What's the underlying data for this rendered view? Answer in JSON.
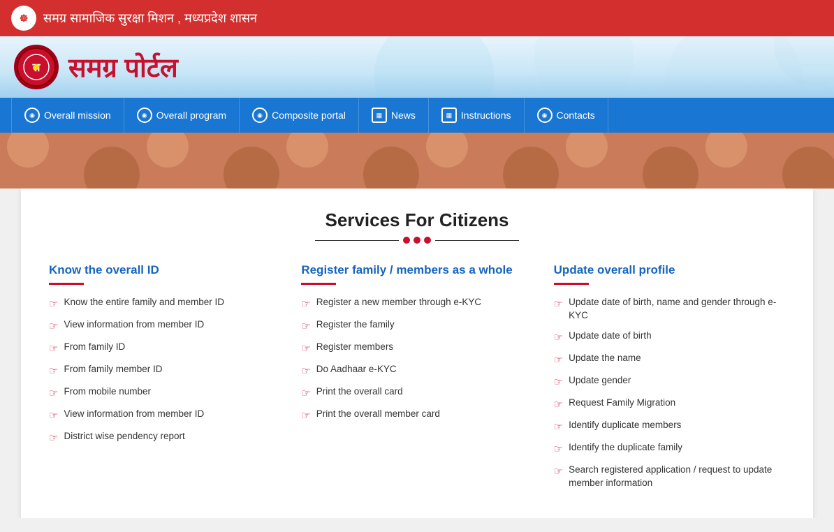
{
  "topHeader": {
    "title": "समग्र सामाजिक सुरक्षा मिशन , मध्यप्रदेश शासन",
    "emblem": "☸"
  },
  "logo": {
    "text": "समग्र पोर्टल",
    "symbol": "स"
  },
  "navbar": {
    "items": [
      {
        "label": "Overall mission",
        "icon": "◉"
      },
      {
        "label": "Overall program",
        "icon": "◉"
      },
      {
        "label": "Composite portal",
        "icon": "◉"
      },
      {
        "label": "News",
        "icon": "▦"
      },
      {
        "label": "Instructions",
        "icon": "▦"
      },
      {
        "label": "Contacts",
        "icon": "◉"
      }
    ]
  },
  "main": {
    "sectionTitle": "Services For Citizens",
    "columns": [
      {
        "title": "Know the overall ID",
        "items": [
          "Know the entire family and member ID",
          "View information from member ID",
          "From family ID",
          "From family member ID",
          "From mobile number",
          "View information from member ID",
          "District wise pendency report"
        ]
      },
      {
        "title": "Register family / members as a whole",
        "items": [
          "Register a new member through e-KYC",
          "Register the family",
          "Register members",
          "Do Aadhaar e-KYC",
          "Print the overall card",
          "Print the overall member card"
        ]
      },
      {
        "title": "Update overall profile",
        "items": [
          "Update date of birth, name and gender through e-KYC",
          "Update date of birth",
          "Update the name",
          "Update gender",
          "Request Family Migration",
          "Identify duplicate members",
          "Identify the duplicate family",
          "Search registered application / request to update member information"
        ]
      }
    ]
  }
}
